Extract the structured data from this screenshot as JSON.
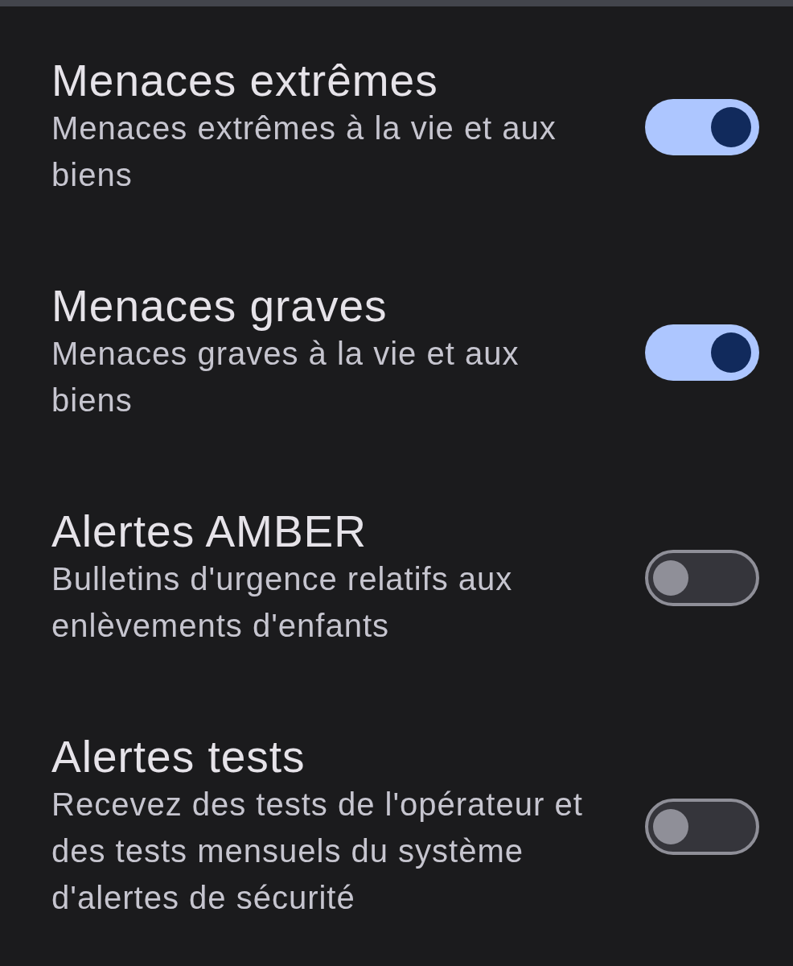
{
  "settings": [
    {
      "title": "Menaces extrêmes",
      "description": "Menaces extrêmes à la vie et aux biens",
      "on": true
    },
    {
      "title": "Menaces graves",
      "description": "Menaces graves à la vie et aux biens",
      "on": true
    },
    {
      "title": "Alertes AMBER",
      "description": "Bulletins d'urgence relatifs aux enlèvements d'enfants",
      "on": false
    },
    {
      "title": "Alertes tests",
      "description": "Recevez des tests de l'opérateur et des tests mensuels du système d'alertes de sécurité",
      "on": false
    }
  ]
}
